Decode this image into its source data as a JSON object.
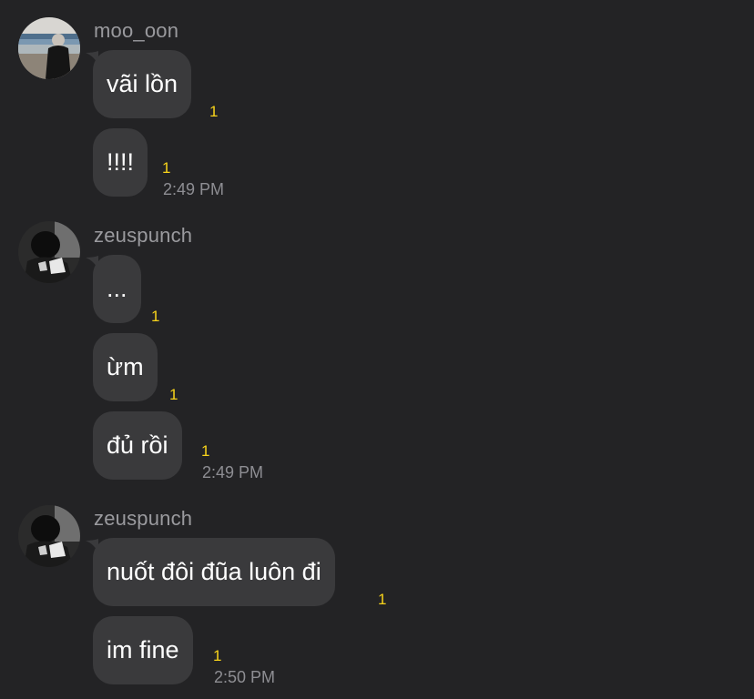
{
  "groups": [
    {
      "username": "moo_oon",
      "avatar": "beach-photo-avatar",
      "messages": [
        {
          "text": "vãi lồn",
          "unread": "1"
        },
        {
          "text": "!!!!",
          "unread": "1",
          "time": "2:49 PM"
        }
      ]
    },
    {
      "username": "zeuspunch",
      "avatar": "dark-photo-avatar",
      "messages": [
        {
          "text": "...",
          "unread": "1"
        },
        {
          "text": "ừm",
          "unread": "1"
        },
        {
          "text": "đủ rồi",
          "unread": "1",
          "time": "2:49 PM"
        }
      ]
    },
    {
      "username": "zeuspunch",
      "avatar": "dark-photo-avatar",
      "messages": [
        {
          "text": "nuốt đôi đũa luôn đi",
          "unread": "1"
        },
        {
          "text": "im fine",
          "unread": "1",
          "time": "2:50 PM"
        }
      ]
    }
  ],
  "colors": {
    "background": "#232325",
    "bubble": "#3a3a3c",
    "unread": "#f7d31b",
    "timestamp": "#8e8e93",
    "username": "#9a9a9e"
  }
}
